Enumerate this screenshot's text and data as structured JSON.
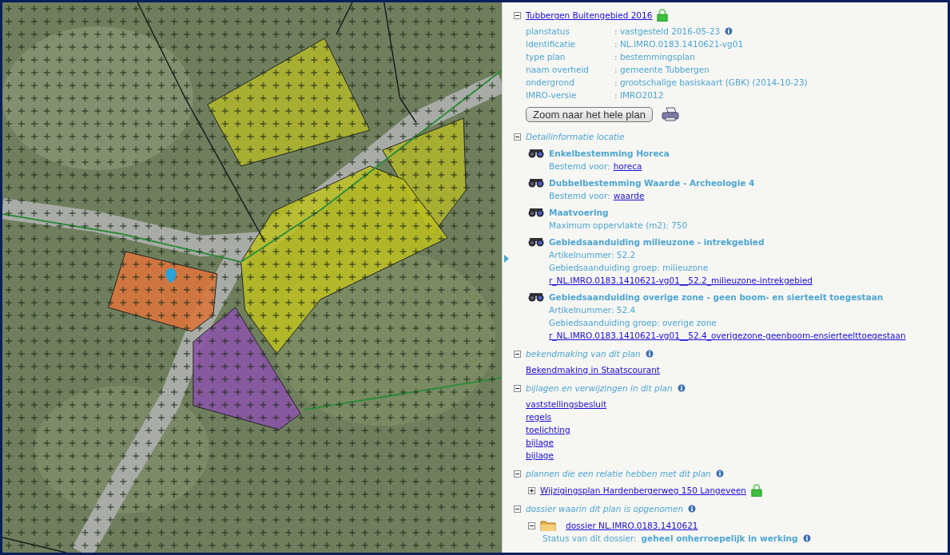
{
  "plan": {
    "title": "Tubbergen Buitengebied 2016",
    "expanded": true,
    "fields": [
      {
        "label": "planstatus",
        "value": ": vastgesteld 2016-05-23",
        "info": true
      },
      {
        "label": "identificatie",
        "value": ": NL.IMRO.0183.1410621-vg01"
      },
      {
        "label": "type plan",
        "value": ": bestemmingsplan"
      },
      {
        "label": "naam overheid",
        "value": ": gemeente Tubbergen"
      },
      {
        "label": "ondergrond",
        "value": ": grootschalige basiskaart (GBK) (2014-10-23)"
      },
      {
        "label": "IMRO-versie",
        "value": ": IMRO2012"
      }
    ],
    "zoom_button": "Zoom naar het hele plan"
  },
  "detail": {
    "title": "Detailinformatie locatie",
    "expanded": true,
    "items": [
      {
        "title": "Enkelbestemming Horeca",
        "lines": [
          {
            "text": "Bestemd voor:",
            "link": "horeca"
          }
        ]
      },
      {
        "title": "Dubbelbestemming Waarde - Archeologie 4",
        "lines": [
          {
            "text": "Bestemd voor:",
            "link": "waarde"
          }
        ]
      },
      {
        "title": "Maatvoering",
        "lines": [
          {
            "text": "Maximum oppervlakte (m2): 750"
          }
        ]
      },
      {
        "title": "Gebiedsaanduiding milieuzone - intrekgebied",
        "lines": [
          {
            "text": "Artikelnummer: 52.2"
          },
          {
            "text": "Gebiedsaanduiding groep: milieuzone"
          },
          {
            "link": "r_NL.IMRO.0183.1410621-vg01__52.2_milieuzone-intrekgebied"
          }
        ]
      },
      {
        "title": "Gebiedsaanduiding overige zone - geen boom- en sierteelt toegestaan",
        "lines": [
          {
            "text": "Artikelnummer: 52.4"
          },
          {
            "text": "Gebiedsaanduiding groep: overige zone"
          },
          {
            "link": "r_NL.IMRO.0183.1410621-vg01__52.4_overigezone-geenboom-ensierteelttoegestaan"
          }
        ]
      }
    ]
  },
  "bekendmaking": {
    "title": "bekendmaking van dit plan",
    "expanded": true,
    "info": true,
    "links": [
      "Bekendmaking in Staatscourant"
    ]
  },
  "bijlagen": {
    "title": "bijlagen en verwijzingen in dit plan",
    "expanded": true,
    "info": true,
    "links": [
      "vaststellingsbesluit",
      "regels",
      "toelichting",
      "bijlage",
      "bijlage"
    ]
  },
  "relaties": {
    "title": "plannen die een relatie hebben met dit plan",
    "expanded": true,
    "info": true,
    "plans": [
      {
        "title": "Wijzigingsplan Hardenbergerweg 150 Langeveen",
        "expanded": false
      }
    ]
  },
  "dossier": {
    "title": "dossier waarin dit plan is opgenomen",
    "expanded": true,
    "info": true,
    "items": [
      {
        "title": "dossier NL.IMRO.0183.1410621",
        "expanded": true,
        "status_label": "Status van dit dossier:",
        "status": "geheel onherroepelijk in werking"
      }
    ]
  }
}
